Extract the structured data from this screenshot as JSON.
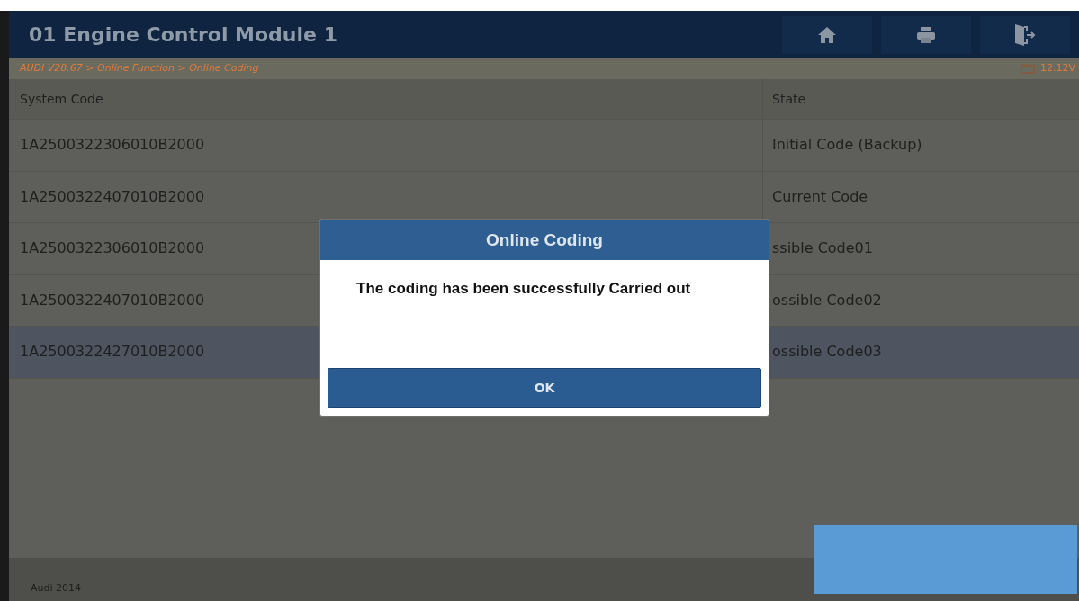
{
  "header": {
    "title": "01 Engine Control Module 1"
  },
  "breadcrumb": {
    "path": "AUDI V28.67 > Online Function > Online Coding",
    "voltage": "12.12V"
  },
  "table": {
    "columns": [
      "System Code",
      "State"
    ],
    "rows": [
      {
        "code": "1A2500322306010B2000",
        "state": "Initial Code (Backup)",
        "selected": false
      },
      {
        "code": "1A2500322407010B2000",
        "state": "Current Code",
        "selected": false
      },
      {
        "code": "1A2500322306010B2000",
        "state": "ssible Code01",
        "selected": false
      },
      {
        "code": "1A2500322407010B2000",
        "state": "ossible Code02",
        "selected": false
      },
      {
        "code": "1A2500322427010B2000",
        "state": "ossible Code03",
        "selected": true
      }
    ]
  },
  "footer": {
    "vehicle": "Audi  2014"
  },
  "dialog": {
    "title": "Online Coding",
    "message": "The coding has been successfully Carried out",
    "button": "OK"
  }
}
